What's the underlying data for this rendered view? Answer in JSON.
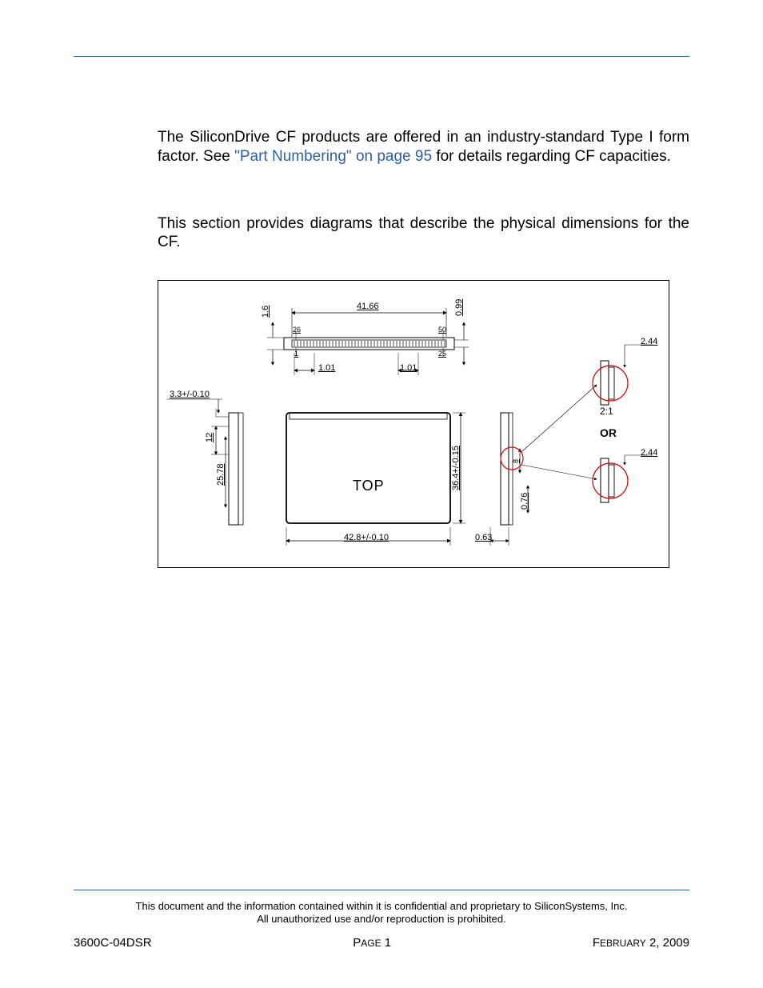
{
  "para1_a": "The SiliconDrive CF products are offered in an industry-standard Type I form factor. See ",
  "para1_link": "\"Part Numbering\" on page 95",
  "para1_b": " for details regarding CF capacities.",
  "para2": "This section provides diagrams that describe the physical dimensions for the CF.",
  "fig": {
    "dim_41_66": "41.66",
    "dim_1_6": "1.6",
    "dim_0_99": "0.99",
    "dim_26": "26",
    "dim_50": "50",
    "dim_1": "1",
    "dim_25": "25",
    "dim_1_01_a": "1.01",
    "dim_1_01_b": "1.01",
    "dim_3_3": "3.3+/-0.10",
    "dim_12": "12",
    "dim_25_78": "25.78",
    "top_label": "TOP",
    "dim_36_4": "36.4+/-0.15",
    "dim_42_8": "42.8+/-0.10",
    "dim_0_63": "0.63",
    "dim_0_76": "0.76",
    "dim_8": "8",
    "or_label": "OR",
    "ratio": "2:1",
    "dim_2_44_a": "2.44",
    "dim_2_44_b": "2.44"
  },
  "disclaimer1": "This document and the information contained within it is confidential and proprietary to SiliconSystems, Inc.",
  "disclaimer2": "All unauthorized use and/or reproduction is prohibited.",
  "footer_left": "3600C-04DSR",
  "footer_center_a": "P",
  "footer_center_b": "AGE",
  "footer_center_c": " 1",
  "footer_right_a": "F",
  "footer_right_b": "EBRUARY",
  "footer_right_c": " 2, 2009"
}
